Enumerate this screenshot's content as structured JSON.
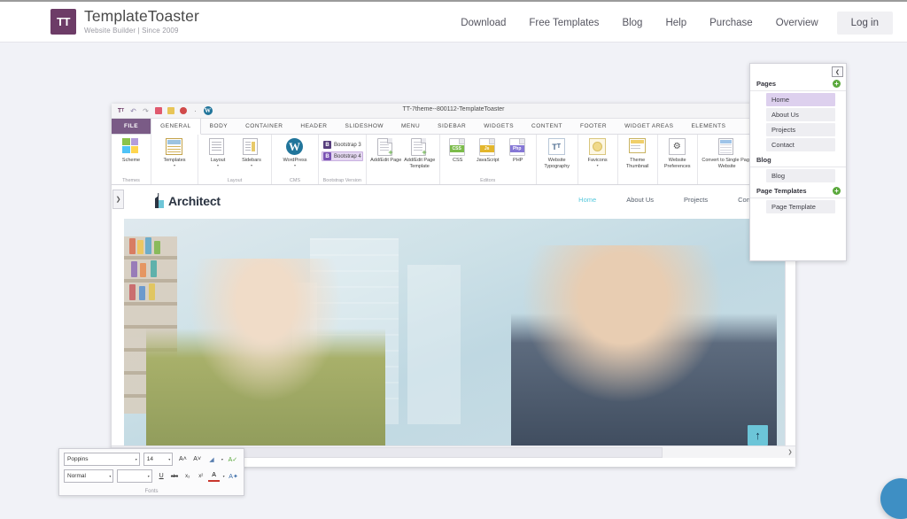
{
  "site_header": {
    "brand": {
      "mark": "TT",
      "name": "TemplateToaster",
      "tagline": "Website Builder | Since 2009"
    },
    "nav": [
      {
        "label": "Download",
        "name": "download"
      },
      {
        "label": "Free Templates",
        "name": "free-templates"
      },
      {
        "label": "Blog",
        "name": "blog"
      },
      {
        "label": "Help",
        "name": "help"
      },
      {
        "label": "Purchase",
        "name": "purchase"
      },
      {
        "label": "Overview",
        "name": "overview"
      }
    ],
    "login_label": "Log in"
  },
  "app": {
    "window_title": "TT-7theme--800112-TemplateToaster",
    "quick_access": [
      {
        "name": "tt-logo-icon",
        "glyph": "Tт"
      },
      {
        "name": "undo-icon",
        "glyph": "↶"
      },
      {
        "name": "redo-icon",
        "glyph": "↷"
      },
      {
        "name": "save-icon",
        "glyph": "▣"
      },
      {
        "name": "export-icon",
        "glyph": "ὑ2"
      },
      {
        "name": "publish-icon",
        "glyph": "●"
      },
      {
        "name": "dot-separator-icon",
        "glyph": "·"
      },
      {
        "name": "wordpress-icon",
        "glyph": "W"
      }
    ],
    "ribbon_tabs": [
      {
        "label": "FILE",
        "name": "file",
        "state": "file"
      },
      {
        "label": "GENERAL",
        "name": "general",
        "state": "active"
      },
      {
        "label": "BODY",
        "name": "body",
        "state": ""
      },
      {
        "label": "CONTAINER",
        "name": "container",
        "state": ""
      },
      {
        "label": "HEADER",
        "name": "header",
        "state": ""
      },
      {
        "label": "SLIDESHOW",
        "name": "slideshow",
        "state": ""
      },
      {
        "label": "MENU",
        "name": "menu",
        "state": ""
      },
      {
        "label": "SIDEBAR",
        "name": "sidebar",
        "state": ""
      },
      {
        "label": "WIDGETS",
        "name": "widgets",
        "state": ""
      },
      {
        "label": "CONTENT",
        "name": "content",
        "state": ""
      },
      {
        "label": "FOOTER",
        "name": "footer",
        "state": ""
      },
      {
        "label": "WIDGET AREAS",
        "name": "widget-areas",
        "state": ""
      },
      {
        "label": "ELEMENTS",
        "name": "elements",
        "state": ""
      }
    ],
    "ribbon_groups": [
      {
        "name": "themes",
        "label": "Themes",
        "items": [
          {
            "label": "Scheme",
            "name": "scheme",
            "caret": false
          }
        ]
      },
      {
        "name": "templates",
        "label": "",
        "items": [
          {
            "label": "Templates",
            "name": "templates",
            "caret": true
          }
        ]
      },
      {
        "name": "layout",
        "label": "Layout",
        "items": [
          {
            "label": "Layout",
            "name": "layout",
            "caret": true
          },
          {
            "label": "Sidebars",
            "name": "sidebars",
            "caret": true
          }
        ]
      },
      {
        "name": "cms",
        "label": "CMS",
        "items": [
          {
            "label": "WordPress",
            "name": "wordpress",
            "caret": true
          }
        ]
      },
      {
        "name": "bootstrap-version",
        "label": "Bootstrap Version",
        "options": [
          {
            "label": "Bootstrap 3",
            "badge": "B",
            "selected": false
          },
          {
            "label": "Bootstrap 4",
            "badge": "B",
            "selected": true
          }
        ]
      },
      {
        "name": "pages",
        "label": "",
        "items": [
          {
            "label": "Add/Edit Page",
            "name": "add-edit-page",
            "caret": false
          },
          {
            "label": "Add/Edit Page Template",
            "name": "add-edit-page-template",
            "caret": false
          }
        ]
      },
      {
        "name": "editors",
        "label": "Editors",
        "items": [
          {
            "label": "CSS",
            "name": "css",
            "caret": false
          },
          {
            "label": "JavaScript",
            "name": "javascript",
            "caret": false
          },
          {
            "label": "PHP",
            "name": "php",
            "caret": false
          }
        ]
      },
      {
        "name": "typography",
        "label": "",
        "items": [
          {
            "label": "Website Typography",
            "name": "website-typography",
            "caret": false
          }
        ]
      },
      {
        "name": "favicons",
        "label": "",
        "items": [
          {
            "label": "Favicons",
            "name": "favicons",
            "caret": true
          }
        ]
      },
      {
        "name": "thumbnail",
        "label": "",
        "items": [
          {
            "label": "Theme Thumbnail",
            "name": "theme-thumbnail",
            "caret": false
          }
        ]
      },
      {
        "name": "preferences",
        "label": "",
        "items": [
          {
            "label": "Website Preferences",
            "name": "website-preferences",
            "caret": false
          }
        ]
      },
      {
        "name": "convert",
        "label": "",
        "items": [
          {
            "label": "Convert to Single Page Website",
            "name": "convert-to-single-page-website",
            "caret": false
          }
        ]
      }
    ]
  },
  "preview": {
    "logo_text": "Architect",
    "nav": [
      {
        "label": "Home",
        "name": "home",
        "active": true
      },
      {
        "label": "About Us",
        "name": "about-us",
        "active": false
      },
      {
        "label": "Projects",
        "name": "projects",
        "active": false
      },
      {
        "label": "Contact",
        "name": "contact",
        "active": false
      }
    ],
    "scroll_top_glyph": "↑"
  },
  "pages_panel": {
    "collapse_glyph": "❮",
    "sections": [
      {
        "title": "Pages",
        "name": "pages",
        "add": "+",
        "has_add": true,
        "items": [
          {
            "label": "Home",
            "name": "home",
            "selected": true
          },
          {
            "label": "About Us",
            "name": "about-us",
            "selected": false
          },
          {
            "label": "Projects",
            "name": "projects",
            "selected": false
          },
          {
            "label": "Contact",
            "name": "contact",
            "selected": false
          }
        ]
      },
      {
        "title": "Blog",
        "name": "blog",
        "add": "",
        "has_add": false,
        "items": [
          {
            "label": "Blog",
            "name": "blog",
            "selected": false
          }
        ]
      },
      {
        "title": "Page Templates",
        "name": "page-templates",
        "add": "+",
        "has_add": true,
        "items": [
          {
            "label": "Page Template",
            "name": "page-template",
            "selected": false
          }
        ]
      }
    ]
  },
  "fonts_panel": {
    "group_label": "Fonts",
    "font_family": "Poppins",
    "font_size": "14",
    "font_style": "Normal",
    "line_height": "",
    "row1_buttons": [
      {
        "name": "grow-font-icon",
        "glyph": "A˄"
      },
      {
        "name": "shrink-font-icon",
        "glyph": "A˅"
      },
      {
        "name": "text-highlight-icon",
        "glyph": "◢"
      },
      {
        "name": "highlight-caret-icon",
        "glyph": "▾"
      },
      {
        "name": "clear-formatting-icon",
        "glyph": "A✓"
      }
    ],
    "row2_buttons": [
      {
        "name": "underline-icon",
        "glyph": "U"
      },
      {
        "name": "strikethrough-icon",
        "glyph": "abc"
      },
      {
        "name": "subscript-icon",
        "glyph": "x₂"
      },
      {
        "name": "superscript-icon",
        "glyph": "x²"
      },
      {
        "name": "font-color-icon",
        "glyph": "A"
      },
      {
        "name": "font-color-caret-icon",
        "glyph": "▾"
      },
      {
        "name": "text-effects-icon",
        "glyph": "A✦"
      }
    ]
  },
  "colors": {
    "brand_purple": "#6d3c67",
    "file_tab_purple": "#7a5b86",
    "accent_cyan": "#56c8dc",
    "add_green": "#5aa83c",
    "selection_lilac": "#ddd0ee",
    "chat_blue": "#3e8fc4"
  }
}
